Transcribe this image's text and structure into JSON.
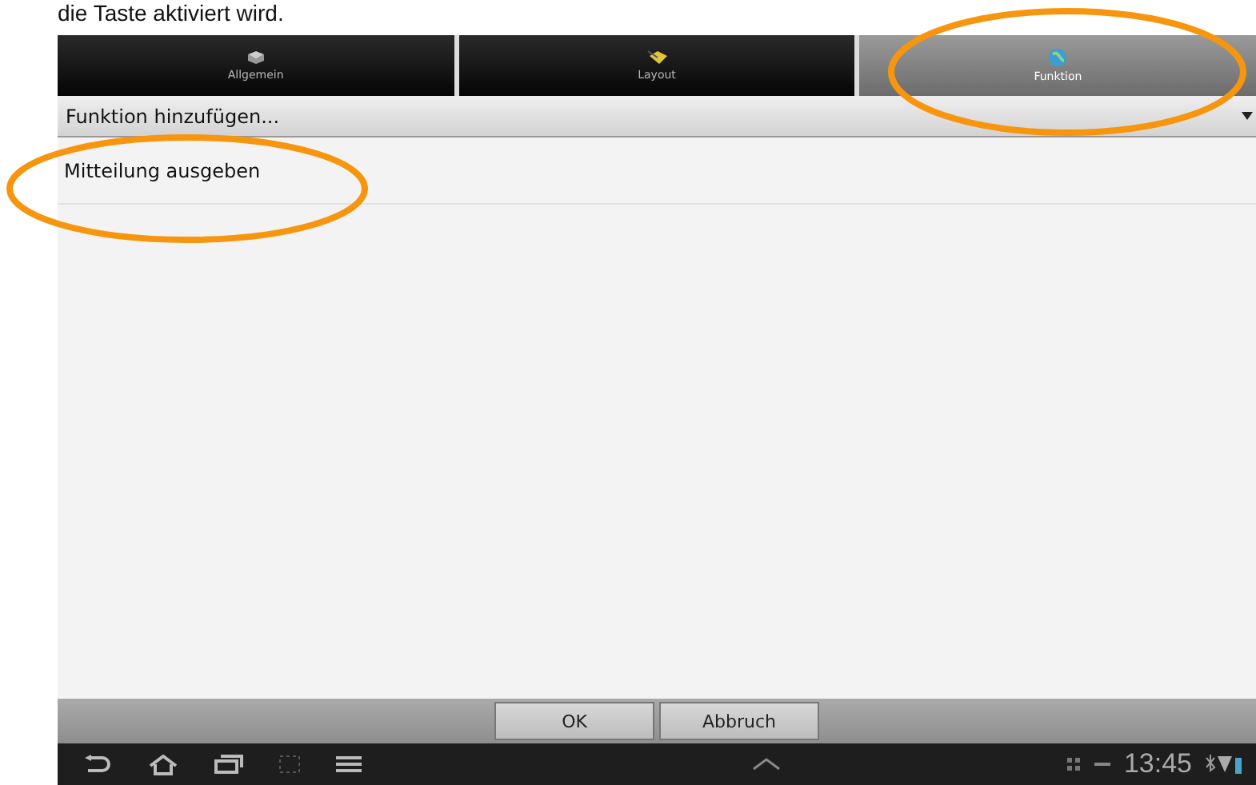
{
  "caption": "die Taste aktiviert wird.",
  "tabs": [
    {
      "label": "Allgemein",
      "selected": false
    },
    {
      "label": "Layout",
      "selected": false
    },
    {
      "label": "Funktion",
      "selected": true
    }
  ],
  "spinner": {
    "text": "Funktion hinzufügen..."
  },
  "list": [
    "Mitteilung ausgeben"
  ],
  "buttons": [
    "OK",
    "Abbruch"
  ],
  "status_bar": {
    "time": "13:45"
  }
}
